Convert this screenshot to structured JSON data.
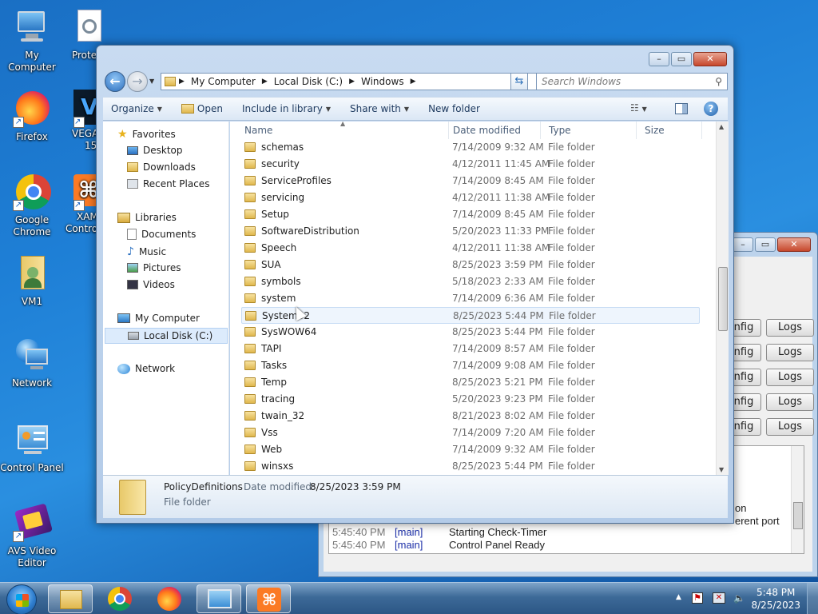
{
  "desktop": {
    "icons": [
      {
        "label": "My Computer"
      },
      {
        "label": "Protein"
      },
      {
        "label": "Firefox"
      },
      {
        "label": "VEGAS",
        "label2": "15."
      },
      {
        "label": "Google",
        "label2": "Chrome"
      },
      {
        "label": "XAM",
        "label2": "Control"
      },
      {
        "label": "VM1"
      },
      {
        "label": "Network"
      },
      {
        "label": "Control Panel"
      },
      {
        "label": "AVS Video",
        "label2": "Editor"
      }
    ]
  },
  "bg_window": {
    "buttons": {
      "config": "nfig",
      "logs": "Logs"
    },
    "log": {
      "partial1": "on",
      "partial2": "erent port",
      "lines": [
        {
          "time": "5:45:40 PM",
          "module": "[main]",
          "message": "Starting Check-Timer"
        },
        {
          "time": "5:45:40 PM",
          "module": "[main]",
          "message": "Control Panel Ready"
        }
      ]
    }
  },
  "explorer": {
    "address": {
      "segments": [
        "My Computer",
        "Local Disk (C:)",
        "Windows"
      ]
    },
    "search": {
      "placeholder": "Search Windows"
    },
    "toolbar": {
      "organize": "Organize",
      "open": "Open",
      "include_in_library": "Include in library",
      "share_with": "Share with",
      "new_folder": "New folder"
    },
    "nav": {
      "favorites": "Favorites",
      "desktop": "Desktop",
      "downloads": "Downloads",
      "recent_places": "Recent Places",
      "libraries": "Libraries",
      "documents": "Documents",
      "music": "Music",
      "pictures": "Pictures",
      "videos": "Videos",
      "my_computer": "My Computer",
      "local_disk": "Local Disk (C:)",
      "network": "Network"
    },
    "columns": {
      "name": "Name",
      "date_modified": "Date modified",
      "type": "Type",
      "size": "Size"
    },
    "files": [
      {
        "name": "schemas",
        "date": "7/14/2009 9:32 AM",
        "type": "File folder"
      },
      {
        "name": "security",
        "date": "4/12/2011 11:45 AM",
        "type": "File folder"
      },
      {
        "name": "ServiceProfiles",
        "date": "7/14/2009 8:45 AM",
        "type": "File folder"
      },
      {
        "name": "servicing",
        "date": "4/12/2011 11:38 AM",
        "type": "File folder"
      },
      {
        "name": "Setup",
        "date": "7/14/2009 8:45 AM",
        "type": "File folder"
      },
      {
        "name": "SoftwareDistribution",
        "date": "5/20/2023 11:33 PM",
        "type": "File folder"
      },
      {
        "name": "Speech",
        "date": "4/12/2011 11:38 AM",
        "type": "File folder"
      },
      {
        "name": "SUA",
        "date": "8/25/2023 3:59 PM",
        "type": "File folder"
      },
      {
        "name": "symbols",
        "date": "5/18/2023 2:33 AM",
        "type": "File folder"
      },
      {
        "name": "system",
        "date": "7/14/2009 6:36 AM",
        "type": "File folder"
      },
      {
        "name": "System32",
        "date": "8/25/2023 5:44 PM",
        "type": "File folder"
      },
      {
        "name": "SysWOW64",
        "date": "8/25/2023 5:44 PM",
        "type": "File folder"
      },
      {
        "name": "TAPI",
        "date": "7/14/2009 8:57 AM",
        "type": "File folder"
      },
      {
        "name": "Tasks",
        "date": "7/14/2009 9:08 AM",
        "type": "File folder"
      },
      {
        "name": "Temp",
        "date": "8/25/2023 5:21 PM",
        "type": "File folder"
      },
      {
        "name": "tracing",
        "date": "5/20/2023 9:23 PM",
        "type": "File folder"
      },
      {
        "name": "twain_32",
        "date": "8/21/2023 8:02 AM",
        "type": "File folder"
      },
      {
        "name": "Vss",
        "date": "7/14/2009 7:20 AM",
        "type": "File folder"
      },
      {
        "name": "Web",
        "date": "7/14/2009 9:32 AM",
        "type": "File folder"
      },
      {
        "name": "winsxs",
        "date": "8/25/2023 5:44 PM",
        "type": "File folder"
      }
    ],
    "details": {
      "name": "PolicyDefinitions",
      "date_label": "Date modified:",
      "date_value": "8/25/2023 3:59 PM",
      "type": "File folder"
    }
  },
  "taskbar": {
    "time": "5:48 PM",
    "date": "8/25/2023"
  }
}
